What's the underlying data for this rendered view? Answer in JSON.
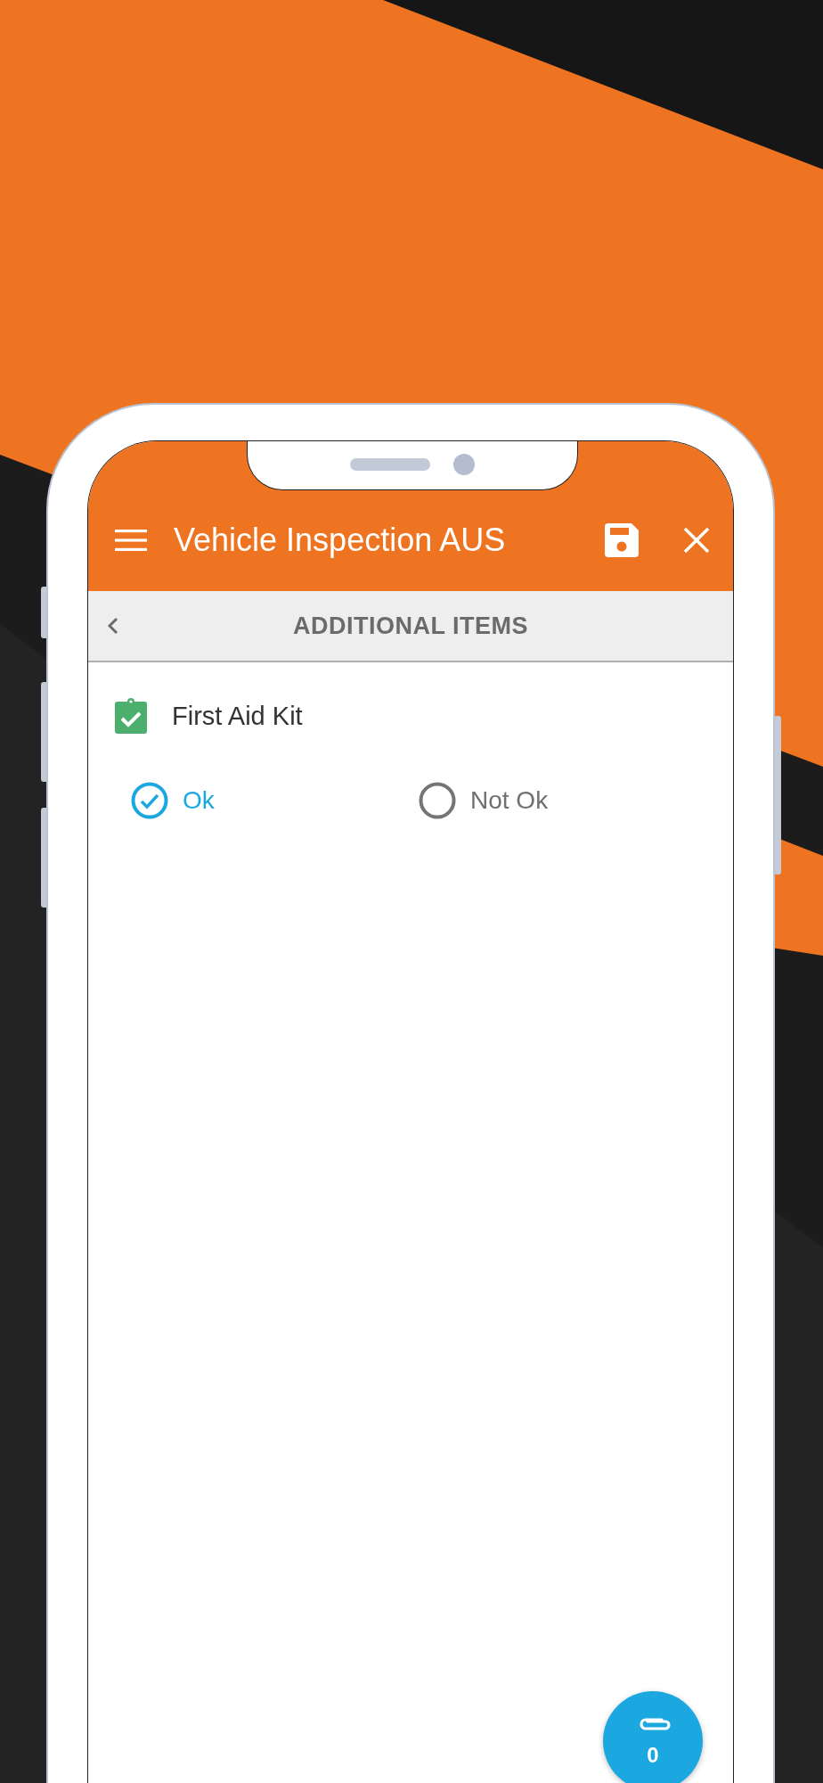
{
  "app_bar": {
    "title": "Vehicle Inspection AUS"
  },
  "section": {
    "title": "ADDITIONAL ITEMS"
  },
  "items": [
    {
      "label": "First Aid Kit",
      "completed": true,
      "options": [
        {
          "label": "Ok",
          "selected": true
        },
        {
          "label": "Not Ok",
          "selected": false
        }
      ]
    }
  ],
  "attachments": {
    "count": "0"
  }
}
